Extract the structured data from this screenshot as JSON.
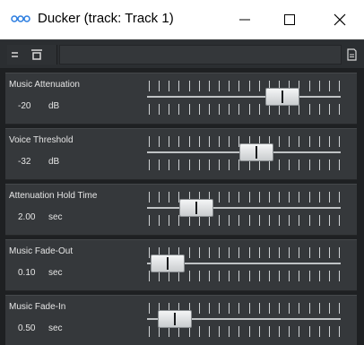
{
  "window": {
    "title": "Ducker (track: Track 1)",
    "icon": "oscilloscope-app-icon",
    "controls": [
      "minimize-icon",
      "maximize-icon",
      "close-icon"
    ]
  },
  "toolbar": {
    "menu_icon": "hamburger-menu-icon",
    "preset_icon": "preset-icon",
    "right_icon": "document-icon",
    "preset_field_value": ""
  },
  "params": [
    {
      "label": "Music Attenuation",
      "value": "-20",
      "unit": "dB",
      "level": 0.74
    },
    {
      "label": "Voice Threshold",
      "value": "-32",
      "unit": "dB",
      "level": 0.58
    },
    {
      "label": "Attenuation Hold Time",
      "value": "2.00",
      "unit": "sec",
      "level": 0.2
    },
    {
      "label": "Music Fade-Out",
      "value": "0.10",
      "unit": "sec",
      "level": 0.02
    },
    {
      "label": "Music Fade-In",
      "value": "0.50",
      "unit": "sec",
      "level": 0.07
    }
  ],
  "colors": {
    "panel_bg": "#35383b",
    "toolbar_bg": "#2b2e31",
    "text": "#e6e6e6",
    "thumb": "#e2e4e6"
  }
}
